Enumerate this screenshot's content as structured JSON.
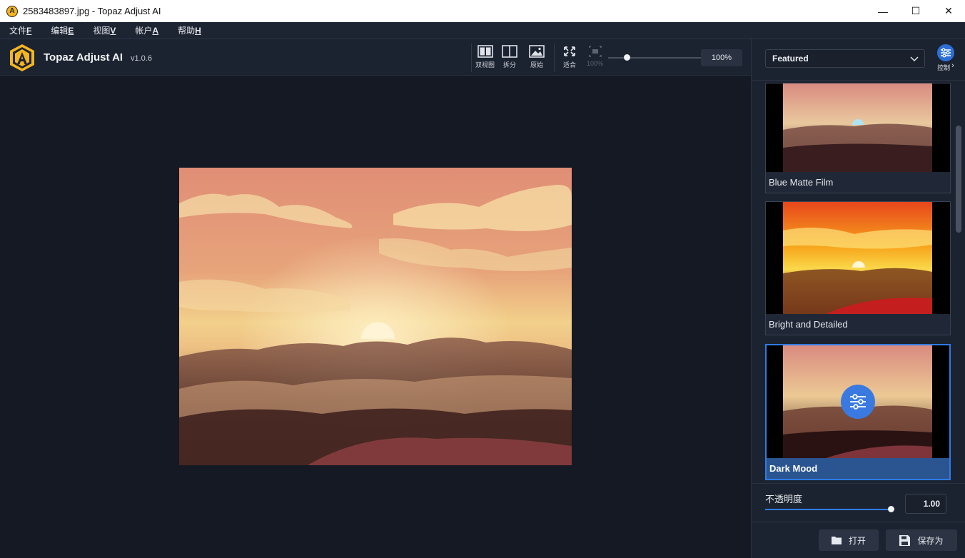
{
  "window": {
    "title": "2583483897.jpg - Topaz Adjust AI",
    "app_icon_letter": "A",
    "minimize": "—",
    "maximize": "☐",
    "close": "✕"
  },
  "menu": [
    {
      "label": "文件",
      "key": "F"
    },
    {
      "label": "编辑",
      "key": "E"
    },
    {
      "label": "视图",
      "key": "V"
    },
    {
      "label": "帐户",
      "key": "A"
    },
    {
      "label": "帮助",
      "key": "H"
    }
  ],
  "header": {
    "brand": "Topaz Adjust AI",
    "version": "v1.0.6",
    "view_buttons": {
      "dual": "双视图",
      "split": "拆分",
      "original": "原始"
    },
    "fit_label": "适合",
    "zoom100_label": "100%",
    "zoom_value": "100%",
    "zoom_slider_fraction": 0.2
  },
  "panel": {
    "preset_dropdown": "Featured",
    "control_label": "控制",
    "control_chevron": "›",
    "presets": [
      {
        "name": "Blue Matte Film",
        "selected": false
      },
      {
        "name": "Bright and Detailed",
        "selected": false
      },
      {
        "name": "Dark Mood",
        "selected": true
      }
    ],
    "opacity_label": "不透明度",
    "opacity_value": "1.00",
    "opacity_fraction": 1.0,
    "open_label": "打开",
    "save_label": "保存为"
  },
  "colors": {
    "accent": "#2f7ae5",
    "logo": "#f5b51f"
  }
}
